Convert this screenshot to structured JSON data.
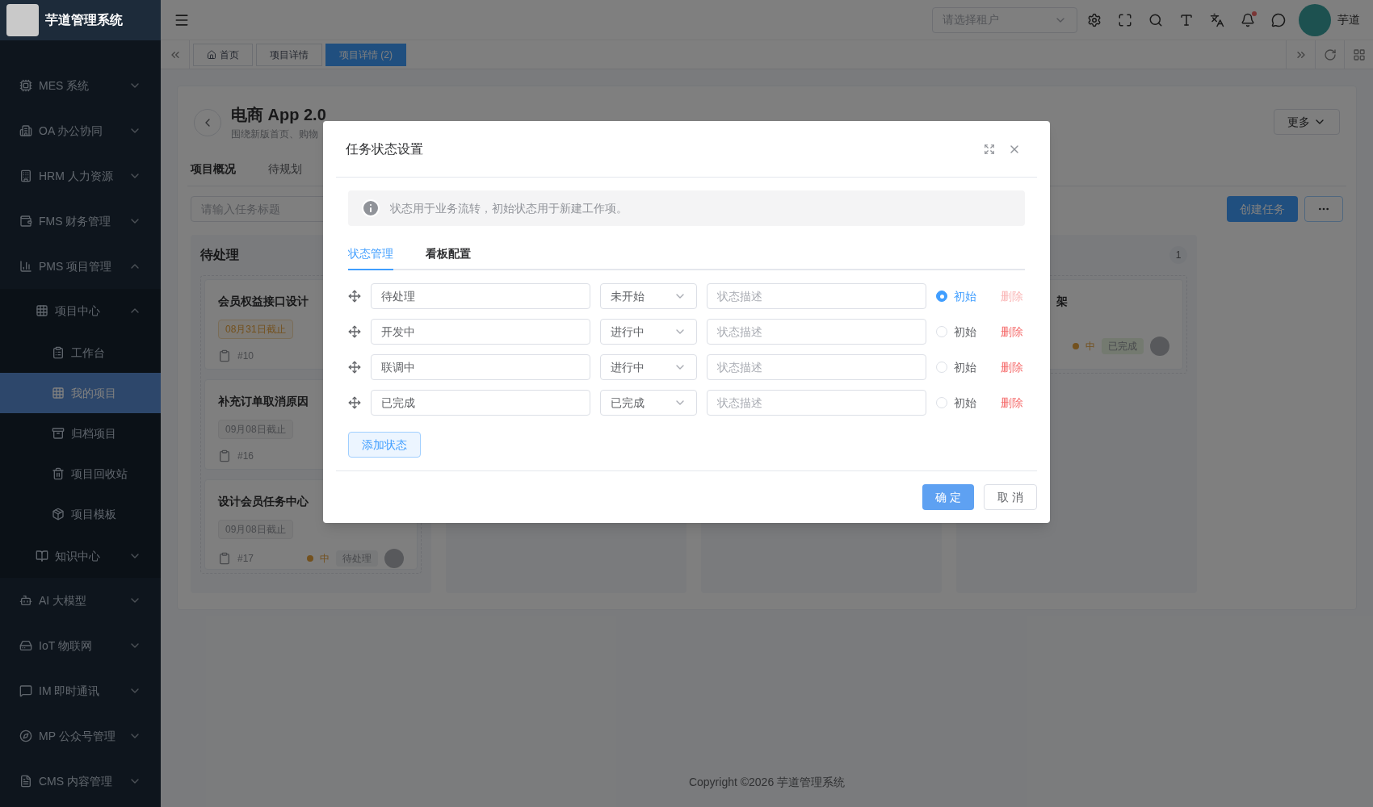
{
  "app": {
    "logo_text": "芋道管理系统"
  },
  "sidebar": {
    "items": [
      {
        "label": "MES 系统",
        "expanded": false
      },
      {
        "label": "OA 办公协同",
        "expanded": false
      },
      {
        "label": "HRM 人力资源",
        "expanded": false
      },
      {
        "label": "FMS 财务管理",
        "expanded": false
      },
      {
        "label": "PMS 项目管理",
        "expanded": true,
        "children": [
          {
            "label": "项目中心",
            "expanded": true,
            "children": [
              {
                "label": "工作台",
                "selected": false
              },
              {
                "label": "我的项目",
                "selected": true
              },
              {
                "label": "归档项目",
                "selected": false
              },
              {
                "label": "项目回收站",
                "selected": false
              },
              {
                "label": "项目模板",
                "selected": false
              }
            ]
          },
          {
            "label": "知识中心",
            "expanded": false
          }
        ]
      },
      {
        "label": "AI 大模型",
        "expanded": false
      },
      {
        "label": "IoT 物联网",
        "expanded": false
      },
      {
        "label": "IM 即时通讯",
        "expanded": false
      },
      {
        "label": "MP 公众号管理",
        "expanded": false
      },
      {
        "label": "CMS 内容管理",
        "expanded": false
      }
    ]
  },
  "header": {
    "tenant_select": {
      "placeholder": "请选择租户"
    },
    "notifications_unread": true,
    "user_name": "芋道"
  },
  "tabs": [
    {
      "label": "首页",
      "selected": false
    },
    {
      "label": "项目详情",
      "selected": false
    },
    {
      "label": "项目详情 (2)",
      "selected": true
    }
  ],
  "project": {
    "title": "电商 App 2.0",
    "subtitle": "围绕新版首页、购物",
    "more_button": "更多",
    "tabs": [
      {
        "label": "项目概况",
        "selected": true
      },
      {
        "label": "待规划",
        "selected": false
      }
    ],
    "search": {
      "placeholder": "请输入任务标题"
    },
    "create_button": "创建任务",
    "board": [
      {
        "title": "待处理",
        "cards": [
          {
            "title": "会员权益接口设计",
            "due": "08月31日截止",
            "overdue": true,
            "number": "#10"
          },
          {
            "title": "补充订单取消原因",
            "due": "09月08日截止",
            "overdue": false,
            "number": "#16"
          },
          {
            "title": "设计会员任务中心",
            "due": "09月08日截止",
            "overdue": false,
            "number": "#17",
            "priority": "中",
            "status": "待处理",
            "color": "#78797a"
          }
        ]
      },
      {
        "count": "1",
        "cards": [
          {
            "title": "架",
            "priority": "中",
            "status": "已完成",
            "color": "#747a70"
          }
        ]
      }
    ]
  },
  "dialog": {
    "title": "任务状态设置",
    "alert": "状态用于业务流转，初始状态用于新建工作项。",
    "tabs": [
      {
        "label": "状态管理",
        "selected": true
      },
      {
        "label": "看板配置",
        "selected": false
      }
    ],
    "rows": [
      {
        "name": "待处理",
        "status": "未开始",
        "description_placeholder": "状态描述",
        "initial_label": "初始",
        "selected": true,
        "delete_label": "删除",
        "delete_disabled": true
      },
      {
        "name": "开发中",
        "status": "进行中",
        "description_placeholder": "状态描述",
        "initial_label": "初始",
        "selected": false,
        "delete_label": "删除",
        "delete_disabled": false
      },
      {
        "name": "联调中",
        "status": "进行中",
        "description_placeholder": "状态描述",
        "initial_label": "初始",
        "selected": false,
        "delete_label": "删除",
        "delete_disabled": false
      },
      {
        "name": "已完成",
        "status": "已完成",
        "description_placeholder": "状态描述",
        "initial_label": "初始",
        "selected": false,
        "delete_label": "删除",
        "delete_disabled": false
      }
    ],
    "add_button": "添加状态",
    "confirm_button": "确 定",
    "cancel_button": "取 消"
  },
  "footer": {
    "copyright": "Copyright ©2026 芋道管理系统"
  }
}
